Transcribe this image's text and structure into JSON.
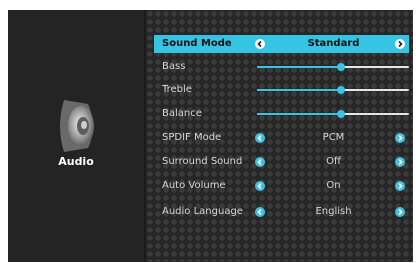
{
  "sidebar": {
    "title": "Audio",
    "icon": "speaker-icon"
  },
  "accent_color": "#35c4e4",
  "menu": {
    "sound_mode": {
      "label": "Sound Mode",
      "value": "Standard"
    },
    "bass": {
      "label": "Bass",
      "level": 0.55
    },
    "treble": {
      "label": "Treble",
      "level": 0.55
    },
    "balance": {
      "label": "Balance",
      "level": 0.55
    },
    "spdif_mode": {
      "label": "SPDIF Mode",
      "value": "PCM"
    },
    "surround_sound": {
      "label": "Surround Sound",
      "value": "Off"
    },
    "auto_volume": {
      "label": "Auto Volume",
      "value": "On"
    },
    "audio_language": {
      "label": "Audio Language",
      "value": "English"
    }
  }
}
